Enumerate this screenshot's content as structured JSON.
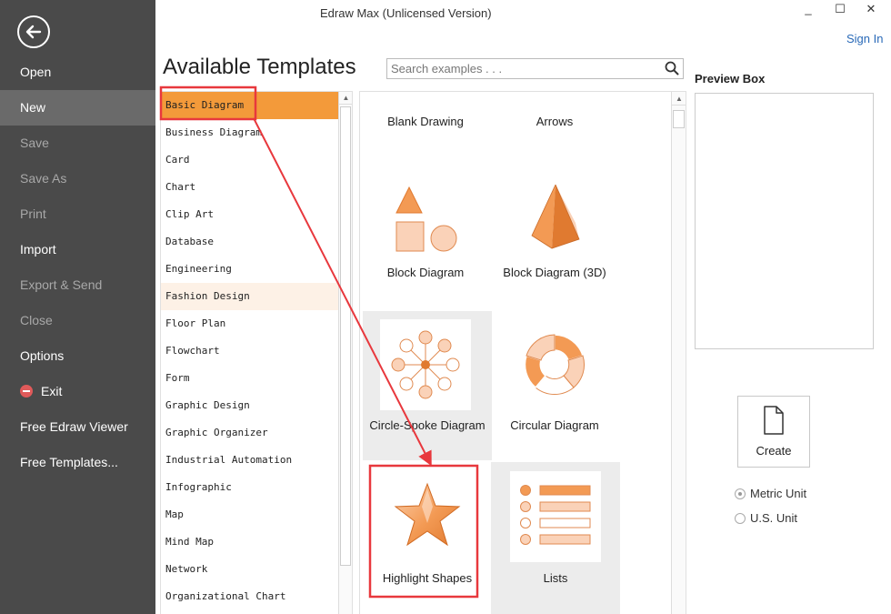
{
  "window": {
    "title": "Edraw Max (Unlicensed Version)",
    "minimize": "_",
    "maximize": "☐",
    "close": "✕",
    "sign_in": "Sign In"
  },
  "sidebar": {
    "items": [
      {
        "label": "Open"
      },
      {
        "label": "New"
      },
      {
        "label": "Save"
      },
      {
        "label": "Save As"
      },
      {
        "label": "Print"
      },
      {
        "label": "Import"
      },
      {
        "label": "Export & Send"
      },
      {
        "label": "Close"
      },
      {
        "label": "Options"
      },
      {
        "label": "Exit"
      },
      {
        "label": "Free Edraw Viewer"
      },
      {
        "label": "Free Templates..."
      }
    ]
  },
  "main": {
    "heading": "Available Templates",
    "search_placeholder": "Search examples . . ."
  },
  "categories": [
    "Basic Diagram",
    "Business Diagram",
    "Card",
    "Chart",
    "Clip Art",
    "Database",
    "Engineering",
    "Fashion Design",
    "Floor Plan",
    "Flowchart",
    "Form",
    "Graphic Design",
    "Graphic Organizer",
    "Industrial Automation",
    "Infographic",
    "Map",
    "Mind Map",
    "Network",
    "Organizational Chart"
  ],
  "templates": [
    {
      "label": "Blank Drawing"
    },
    {
      "label": "Arrows"
    },
    {
      "label": "Block Diagram"
    },
    {
      "label": "Block Diagram (3D)"
    },
    {
      "label": "Circle-Spoke Diagram"
    },
    {
      "label": "Circular Diagram"
    },
    {
      "label": "Highlight Shapes"
    },
    {
      "label": "Lists"
    }
  ],
  "preview": {
    "title": "Preview Box",
    "create_label": "Create",
    "units": [
      "Metric Unit",
      "U.S. Unit"
    ]
  },
  "colors": {
    "sidebar_bg": "#4a4a4a",
    "accent_orange": "#f39a3a",
    "annotation_red": "#e8383d",
    "link_blue": "#2a6ab8"
  }
}
